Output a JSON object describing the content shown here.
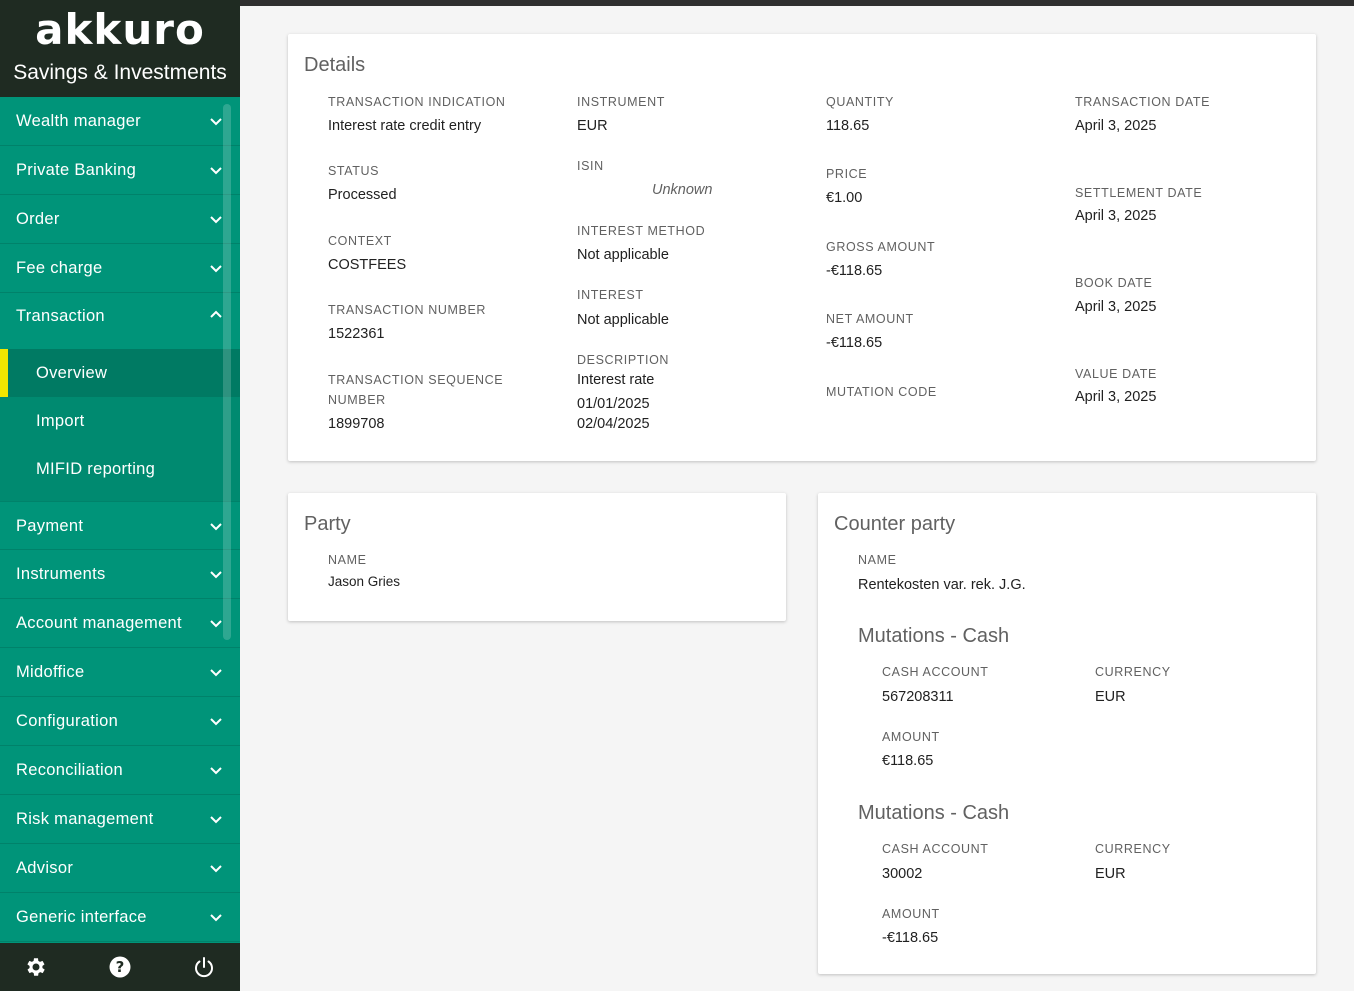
{
  "brand": {
    "logo": "akkuro",
    "subtitle": "Savings & Investments"
  },
  "colors": {
    "sidebar": "#009479",
    "sidebar_dark": "#1f2b22",
    "active_marker": "#f2e600"
  },
  "nav": {
    "items_top": [
      {
        "label": "Wealth manager",
        "icon": "chevron-down-icon"
      },
      {
        "label": "Private Banking",
        "icon": "chevron-down-icon"
      },
      {
        "label": "Order",
        "icon": "chevron-down-icon"
      },
      {
        "label": "Fee charge",
        "icon": "chevron-down-icon"
      },
      {
        "label": "Transaction",
        "icon": "chevron-up-icon"
      }
    ],
    "sub_items": [
      {
        "label": "Overview"
      },
      {
        "label": "Import"
      },
      {
        "label": "MIFID reporting"
      }
    ],
    "items_bottom": [
      {
        "label": "Payment"
      },
      {
        "label": "Instruments"
      },
      {
        "label": "Account management"
      },
      {
        "label": "Midoffice"
      },
      {
        "label": "Configuration"
      },
      {
        "label": "Reconciliation"
      },
      {
        "label": "Risk management"
      },
      {
        "label": "Advisor"
      },
      {
        "label": "Generic interface"
      }
    ],
    "footer_icons": [
      "gear-icon",
      "help-icon",
      "power-icon"
    ]
  },
  "details": {
    "title": "Details",
    "transaction_indication": {
      "label": "TRANSACTION INDICATION",
      "value": "Interest rate credit entry"
    },
    "status": {
      "label": "STATUS",
      "value": "Processed"
    },
    "context": {
      "label": "CONTEXT",
      "value": "COSTFEES"
    },
    "transaction_number": {
      "label": "TRANSACTION NUMBER",
      "value": "1522361"
    },
    "transaction_sequence": {
      "label_line1": "TRANSACTION SEQUENCE",
      "label_line2": "NUMBER",
      "value": "1899708"
    },
    "instrument": {
      "label": "INSTRUMENT",
      "value": "EUR"
    },
    "isin": {
      "label": "ISIN",
      "value": "Unknown"
    },
    "interest_method": {
      "label": "INTEREST METHOD",
      "value": "Not applicable"
    },
    "interest": {
      "label": "INTEREST",
      "value": "Not applicable"
    },
    "description": {
      "label": "DESCRIPTION",
      "line1": "Interest rate",
      "line2": "01/01/2025",
      "line3": "02/04/2025"
    },
    "quantity": {
      "label": "QUANTITY",
      "value": "118.65"
    },
    "price": {
      "label": "PRICE",
      "value": "€1.00"
    },
    "gross_amount": {
      "label": "GROSS AMOUNT",
      "value": "-€118.65"
    },
    "net_amount": {
      "label": "NET AMOUNT",
      "value": "-€118.65"
    },
    "mutation_code": {
      "label": "MUTATION CODE"
    },
    "transaction_date": {
      "label": "TRANSACTION DATE",
      "value": "April 3, 2025"
    },
    "settlement_date": {
      "label": "SETTLEMENT DATE",
      "value": "April 3, 2025"
    },
    "book_date": {
      "label": "BOOK DATE",
      "value": "April 3, 2025"
    },
    "value_date": {
      "label": "VALUE DATE",
      "value": "April 3, 2025"
    }
  },
  "party": {
    "title": "Party",
    "name_label": "NAME",
    "name_value": "Jason Gries"
  },
  "counter_party": {
    "title": "Counter party",
    "name_label": "NAME",
    "name_value": "Rentekosten var. rek. J.G.",
    "mutations": [
      {
        "title": "Mutations - Cash",
        "cash_account_label": "CASH ACCOUNT",
        "cash_account": "567208311",
        "currency_label": "CURRENCY",
        "currency": "EUR",
        "amount_label": "AMOUNT",
        "amount": "€118.65"
      },
      {
        "title": "Mutations - Cash",
        "cash_account_label": "CASH ACCOUNT",
        "cash_account": "30002",
        "currency_label": "CURRENCY",
        "currency": "EUR",
        "amount_label": "AMOUNT",
        "amount": "-€118.65"
      }
    ]
  }
}
